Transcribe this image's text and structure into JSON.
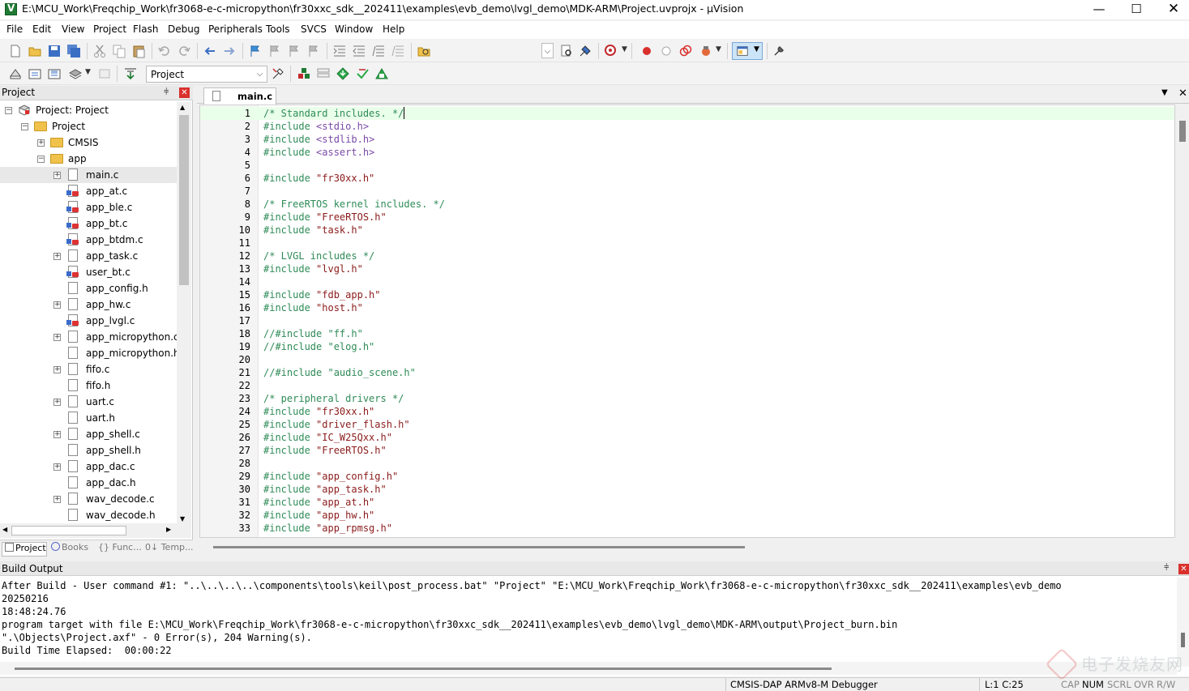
{
  "window": {
    "title": "E:\\MCU_Work\\Freqchip_Work\\fr3068-e-c-micropython\\fr30xxc_sdk__202411\\examples\\evb_demo\\lvgl_demo\\MDK-ARM\\Project.uvprojx - µVision",
    "minimize": "—",
    "maximize": "☐",
    "close": "✕"
  },
  "menu": [
    "File",
    "Edit",
    "View",
    "Project",
    "Flash",
    "Debug",
    "Peripherals",
    "Tools",
    "SVCS",
    "Window",
    "Help"
  ],
  "toolbar2": {
    "target_select": "Project"
  },
  "project_pane": {
    "title": "Project",
    "pin": "⫩",
    "close": "✕",
    "tree": [
      {
        "label": "Project: Project",
        "level": 0,
        "type": "project",
        "expander": "−"
      },
      {
        "label": "Project",
        "level": 1,
        "type": "folder",
        "expander": "−"
      },
      {
        "label": "CMSIS",
        "level": 2,
        "type": "folder",
        "expander": "+"
      },
      {
        "label": "app",
        "level": 2,
        "type": "folder",
        "expander": "−"
      },
      {
        "label": "main.c",
        "level": 3,
        "type": "file",
        "expander": "+",
        "selected": true
      },
      {
        "label": "app_at.c",
        "level": 3,
        "type": "locked-file"
      },
      {
        "label": "app_ble.c",
        "level": 3,
        "type": "locked-file"
      },
      {
        "label": "app_bt.c",
        "level": 3,
        "type": "locked-file"
      },
      {
        "label": "app_btdm.c",
        "level": 3,
        "type": "locked-file"
      },
      {
        "label": "app_task.c",
        "level": 3,
        "type": "file",
        "expander": "+"
      },
      {
        "label": "user_bt.c",
        "level": 3,
        "type": "locked-file"
      },
      {
        "label": "app_config.h",
        "level": 3,
        "type": "file"
      },
      {
        "label": "app_hw.c",
        "level": 3,
        "type": "file",
        "expander": "+"
      },
      {
        "label": "app_lvgl.c",
        "level": 3,
        "type": "locked-file"
      },
      {
        "label": "app_micropython.c",
        "level": 3,
        "type": "file",
        "expander": "+"
      },
      {
        "label": "app_micropython.h",
        "level": 3,
        "type": "file"
      },
      {
        "label": "fifo.c",
        "level": 3,
        "type": "file",
        "expander": "+"
      },
      {
        "label": "fifo.h",
        "level": 3,
        "type": "file"
      },
      {
        "label": "uart.c",
        "level": 3,
        "type": "file",
        "expander": "+"
      },
      {
        "label": "uart.h",
        "level": 3,
        "type": "file"
      },
      {
        "label": "app_shell.c",
        "level": 3,
        "type": "file",
        "expander": "+"
      },
      {
        "label": "app_shell.h",
        "level": 3,
        "type": "file"
      },
      {
        "label": "app_dac.c",
        "level": 3,
        "type": "file",
        "expander": "+"
      },
      {
        "label": "app_dac.h",
        "level": 3,
        "type": "file"
      },
      {
        "label": "wav_decode.c",
        "level": 3,
        "type": "file",
        "expander": "+"
      },
      {
        "label": "wav_decode.h",
        "level": 3,
        "type": "file"
      }
    ],
    "tabs": [
      {
        "label": "Project",
        "active": true
      },
      {
        "label": "Books",
        "active": false
      },
      {
        "label": "{} Func...",
        "active": false
      },
      {
        "label": "0↓ Temp...",
        "active": false
      }
    ]
  },
  "editor": {
    "tab_label": "main.c",
    "tab_dropdown": "▼",
    "tab_close": "✕",
    "current_line": 1,
    "lines": [
      {
        "n": "1",
        "parts": [
          {
            "t": "/* Standard includes. */",
            "c": "comment"
          }
        ]
      },
      {
        "n": "2",
        "parts": [
          {
            "t": "#include ",
            "c": "pre"
          },
          {
            "t": "<stdio.h>",
            "c": "angle"
          }
        ]
      },
      {
        "n": "3",
        "parts": [
          {
            "t": "#include ",
            "c": "pre"
          },
          {
            "t": "<stdlib.h>",
            "c": "angle"
          }
        ]
      },
      {
        "n": "4",
        "parts": [
          {
            "t": "#include ",
            "c": "pre"
          },
          {
            "t": "<assert.h>",
            "c": "angle"
          }
        ]
      },
      {
        "n": "5",
        "parts": []
      },
      {
        "n": "6",
        "parts": [
          {
            "t": "#include ",
            "c": "pre"
          },
          {
            "t": "\"fr30xx.h\"",
            "c": "str"
          }
        ]
      },
      {
        "n": "7",
        "parts": []
      },
      {
        "n": "8",
        "parts": [
          {
            "t": "/* FreeRTOS kernel includes. */",
            "c": "comment"
          }
        ]
      },
      {
        "n": "9",
        "parts": [
          {
            "t": "#include ",
            "c": "pre"
          },
          {
            "t": "\"FreeRTOS.h\"",
            "c": "str"
          }
        ]
      },
      {
        "n": "10",
        "parts": [
          {
            "t": "#include ",
            "c": "pre"
          },
          {
            "t": "\"task.h\"",
            "c": "str"
          }
        ]
      },
      {
        "n": "11",
        "parts": []
      },
      {
        "n": "12",
        "parts": [
          {
            "t": "/* LVGL includes */",
            "c": "comment"
          }
        ]
      },
      {
        "n": "13",
        "parts": [
          {
            "t": "#include ",
            "c": "pre"
          },
          {
            "t": "\"lvgl.h\"",
            "c": "str"
          }
        ]
      },
      {
        "n": "14",
        "parts": []
      },
      {
        "n": "15",
        "parts": [
          {
            "t": "#include ",
            "c": "pre"
          },
          {
            "t": "\"fdb_app.h\"",
            "c": "str"
          }
        ]
      },
      {
        "n": "16",
        "parts": [
          {
            "t": "#include ",
            "c": "pre"
          },
          {
            "t": "\"host.h\"",
            "c": "str"
          }
        ]
      },
      {
        "n": "17",
        "parts": []
      },
      {
        "n": "18",
        "parts": [
          {
            "t": "//#include \"ff.h\"",
            "c": "comment"
          }
        ]
      },
      {
        "n": "19",
        "parts": [
          {
            "t": "//#include \"elog.h\"",
            "c": "comment"
          }
        ]
      },
      {
        "n": "20",
        "parts": []
      },
      {
        "n": "21",
        "parts": [
          {
            "t": "//#include \"audio_scene.h\"",
            "c": "comment"
          }
        ]
      },
      {
        "n": "22",
        "parts": []
      },
      {
        "n": "23",
        "parts": [
          {
            "t": "/* peripheral drivers */",
            "c": "comment"
          }
        ]
      },
      {
        "n": "24",
        "parts": [
          {
            "t": "#include ",
            "c": "pre"
          },
          {
            "t": "\"fr30xx.h\"",
            "c": "str"
          }
        ]
      },
      {
        "n": "25",
        "parts": [
          {
            "t": "#include ",
            "c": "pre"
          },
          {
            "t": "\"driver_flash.h\"",
            "c": "str"
          }
        ]
      },
      {
        "n": "26",
        "parts": [
          {
            "t": "#include ",
            "c": "pre"
          },
          {
            "t": "\"IC_W25Qxx.h\"",
            "c": "str"
          }
        ]
      },
      {
        "n": "27",
        "parts": [
          {
            "t": "#include ",
            "c": "pre"
          },
          {
            "t": "\"FreeRTOS.h\"",
            "c": "str"
          }
        ]
      },
      {
        "n": "28",
        "parts": []
      },
      {
        "n": "29",
        "parts": [
          {
            "t": "#include ",
            "c": "pre"
          },
          {
            "t": "\"app_config.h\"",
            "c": "str"
          }
        ]
      },
      {
        "n": "30",
        "parts": [
          {
            "t": "#include ",
            "c": "pre"
          },
          {
            "t": "\"app_task.h\"",
            "c": "str"
          }
        ]
      },
      {
        "n": "31",
        "parts": [
          {
            "t": "#include ",
            "c": "pre"
          },
          {
            "t": "\"app_at.h\"",
            "c": "str"
          }
        ]
      },
      {
        "n": "32",
        "parts": [
          {
            "t": "#include ",
            "c": "pre"
          },
          {
            "t": "\"app_hw.h\"",
            "c": "str"
          }
        ]
      },
      {
        "n": "33",
        "parts": [
          {
            "t": "#include ",
            "c": "pre"
          },
          {
            "t": "\"app_rpmsg.h\"",
            "c": "str"
          }
        ]
      }
    ]
  },
  "build_output": {
    "title": "Build Output",
    "pin": "⫩",
    "close": "✕",
    "lines": [
      "After Build - User command #1: \"..\\..\\..\\..\\components\\tools\\keil\\post_process.bat\" \"Project\" \"E:\\MCU_Work\\Freqchip_Work\\fr3068-e-c-micropython\\fr30xxc_sdk__202411\\examples\\evb_demo",
      "20250216",
      "18:48:24.76",
      "program target with file E:\\MCU_Work\\Freqchip_Work\\fr3068-e-c-micropython\\fr30xxc_sdk__202411\\examples\\evb_demo\\lvgl_demo\\MDK-ARM\\output\\Project_burn.bin",
      "\".\\Objects\\Project.axf\" - 0 Error(s), 204 Warning(s).",
      "Build Time Elapsed:  00:00:22"
    ]
  },
  "status": {
    "debugger": "CMSIS-DAP ARMv8-M Debugger",
    "position": "L:1 C:25",
    "cap": "CAP",
    "num": "NUM",
    "scrl": "SCRL",
    "ovr": "OVR",
    "rw": "R/W"
  },
  "watermark": {
    "text": "电子发烧友网"
  },
  "colors": {
    "comment": "#2e8b57",
    "string": "#8b1a1a",
    "angle_include": "#7a4aa8",
    "current_line": "#eaffea",
    "close_red": "#d9302c"
  }
}
